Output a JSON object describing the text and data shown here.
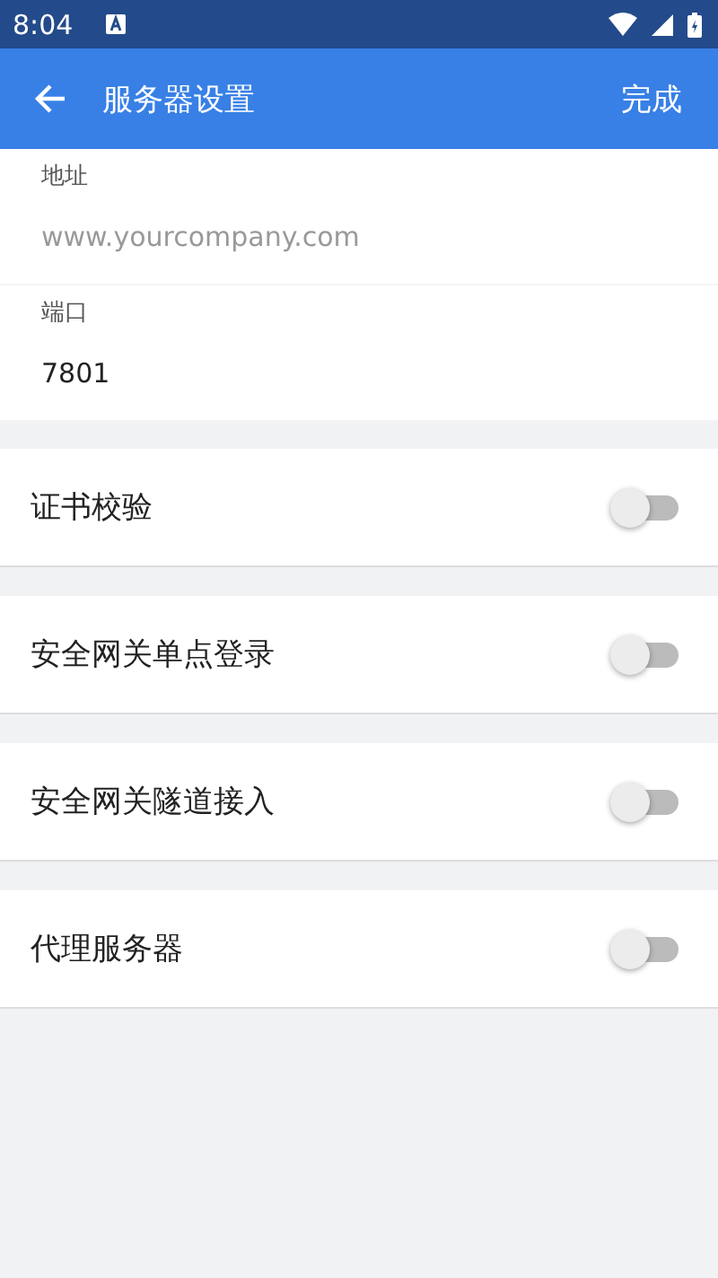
{
  "status_bar": {
    "time": "8:04"
  },
  "app_bar": {
    "title": "服务器设置",
    "action": "完成"
  },
  "fields": [
    {
      "label": "地址",
      "placeholder": "www.yourcompany.com"
    },
    {
      "label": "端口",
      "value": "7801"
    }
  ],
  "switches": [
    {
      "label": "证书校验",
      "on": false
    },
    {
      "label": "安全网关单点登录",
      "on": false
    },
    {
      "label": "安全网关隧道接入",
      "on": false
    },
    {
      "label": "代理服务器",
      "on": false
    }
  ]
}
